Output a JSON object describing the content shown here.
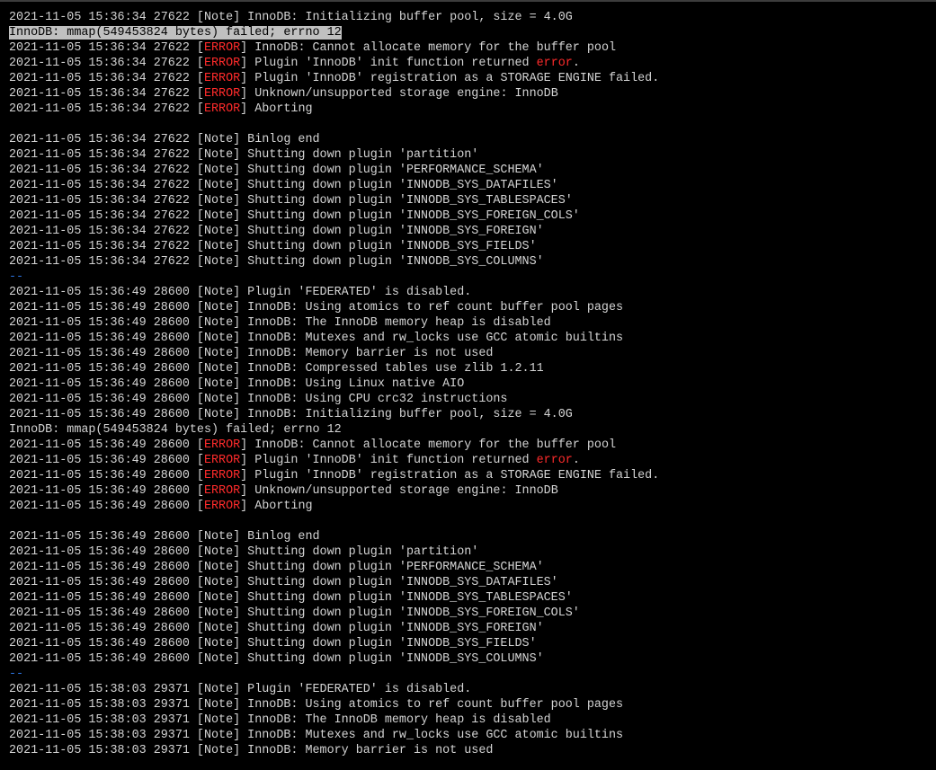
{
  "terminal": {
    "colors": {
      "background": "#000000",
      "text": "#d4d4d4",
      "error": "#ff2b2b",
      "separator": "#2a6fd6",
      "selection": "#c0c0c0"
    },
    "lines": [
      {
        "text": "2021-11-05 15:36:34 27622 [Note] InnoDB: Initializing buffer pool, size = 4.0G"
      },
      {
        "text": "InnoDB: mmap(549453824 bytes) failed; errno 12",
        "highlight": true
      },
      {
        "prefix": "2021-11-05 15:36:34 27622 [",
        "err": "ERROR",
        "suffix": "] InnoDB: Cannot allocate memory for the buffer pool"
      },
      {
        "prefix": "2021-11-05 15:36:34 27622 [",
        "err": "ERROR",
        "suffix": "] Plugin 'InnoDB' init function returned ",
        "err2": "error",
        "tail": "."
      },
      {
        "prefix": "2021-11-05 15:36:34 27622 [",
        "err": "ERROR",
        "suffix": "] Plugin 'InnoDB' registration as a STORAGE ENGINE failed."
      },
      {
        "prefix": "2021-11-05 15:36:34 27622 [",
        "err": "ERROR",
        "suffix": "] Unknown/unsupported storage engine: InnoDB"
      },
      {
        "prefix": "2021-11-05 15:36:34 27622 [",
        "err": "ERROR",
        "suffix": "] Aborting"
      },
      {
        "text": ""
      },
      {
        "text": "2021-11-05 15:36:34 27622 [Note] Binlog end"
      },
      {
        "text": "2021-11-05 15:36:34 27622 [Note] Shutting down plugin 'partition'"
      },
      {
        "text": "2021-11-05 15:36:34 27622 [Note] Shutting down plugin 'PERFORMANCE_SCHEMA'"
      },
      {
        "text": "2021-11-05 15:36:34 27622 [Note] Shutting down plugin 'INNODB_SYS_DATAFILES'"
      },
      {
        "text": "2021-11-05 15:36:34 27622 [Note] Shutting down plugin 'INNODB_SYS_TABLESPACES'"
      },
      {
        "text": "2021-11-05 15:36:34 27622 [Note] Shutting down plugin 'INNODB_SYS_FOREIGN_COLS'"
      },
      {
        "text": "2021-11-05 15:36:34 27622 [Note] Shutting down plugin 'INNODB_SYS_FOREIGN'"
      },
      {
        "text": "2021-11-05 15:36:34 27622 [Note] Shutting down plugin 'INNODB_SYS_FIELDS'"
      },
      {
        "text": "2021-11-05 15:36:34 27622 [Note] Shutting down plugin 'INNODB_SYS_COLUMNS'"
      },
      {
        "text": "--",
        "separator": true
      },
      {
        "text": "2021-11-05 15:36:49 28600 [Note] Plugin 'FEDERATED' is disabled."
      },
      {
        "text": "2021-11-05 15:36:49 28600 [Note] InnoDB: Using atomics to ref count buffer pool pages"
      },
      {
        "text": "2021-11-05 15:36:49 28600 [Note] InnoDB: The InnoDB memory heap is disabled"
      },
      {
        "text": "2021-11-05 15:36:49 28600 [Note] InnoDB: Mutexes and rw_locks use GCC atomic builtins"
      },
      {
        "text": "2021-11-05 15:36:49 28600 [Note] InnoDB: Memory barrier is not used"
      },
      {
        "text": "2021-11-05 15:36:49 28600 [Note] InnoDB: Compressed tables use zlib 1.2.11"
      },
      {
        "text": "2021-11-05 15:36:49 28600 [Note] InnoDB: Using Linux native AIO"
      },
      {
        "text": "2021-11-05 15:36:49 28600 [Note] InnoDB: Using CPU crc32 instructions"
      },
      {
        "text": "2021-11-05 15:36:49 28600 [Note] InnoDB: Initializing buffer pool, size = 4.0G"
      },
      {
        "text": "InnoDB: mmap(549453824 bytes) failed; errno 12"
      },
      {
        "prefix": "2021-11-05 15:36:49 28600 [",
        "err": "ERROR",
        "suffix": "] InnoDB: Cannot allocate memory for the buffer pool"
      },
      {
        "prefix": "2021-11-05 15:36:49 28600 [",
        "err": "ERROR",
        "suffix": "] Plugin 'InnoDB' init function returned ",
        "err2": "error",
        "tail": "."
      },
      {
        "prefix": "2021-11-05 15:36:49 28600 [",
        "err": "ERROR",
        "suffix": "] Plugin 'InnoDB' registration as a STORAGE ENGINE failed."
      },
      {
        "prefix": "2021-11-05 15:36:49 28600 [",
        "err": "ERROR",
        "suffix": "] Unknown/unsupported storage engine: InnoDB"
      },
      {
        "prefix": "2021-11-05 15:36:49 28600 [",
        "err": "ERROR",
        "suffix": "] Aborting"
      },
      {
        "text": ""
      },
      {
        "text": "2021-11-05 15:36:49 28600 [Note] Binlog end"
      },
      {
        "text": "2021-11-05 15:36:49 28600 [Note] Shutting down plugin 'partition'"
      },
      {
        "text": "2021-11-05 15:36:49 28600 [Note] Shutting down plugin 'PERFORMANCE_SCHEMA'"
      },
      {
        "text": "2021-11-05 15:36:49 28600 [Note] Shutting down plugin 'INNODB_SYS_DATAFILES'"
      },
      {
        "text": "2021-11-05 15:36:49 28600 [Note] Shutting down plugin 'INNODB_SYS_TABLESPACES'"
      },
      {
        "text": "2021-11-05 15:36:49 28600 [Note] Shutting down plugin 'INNODB_SYS_FOREIGN_COLS'"
      },
      {
        "text": "2021-11-05 15:36:49 28600 [Note] Shutting down plugin 'INNODB_SYS_FOREIGN'"
      },
      {
        "text": "2021-11-05 15:36:49 28600 [Note] Shutting down plugin 'INNODB_SYS_FIELDS'"
      },
      {
        "text": "2021-11-05 15:36:49 28600 [Note] Shutting down plugin 'INNODB_SYS_COLUMNS'"
      },
      {
        "text": "--",
        "separator": true
      },
      {
        "text": "2021-11-05 15:38:03 29371 [Note] Plugin 'FEDERATED' is disabled."
      },
      {
        "text": "2021-11-05 15:38:03 29371 [Note] InnoDB: Using atomics to ref count buffer pool pages"
      },
      {
        "text": "2021-11-05 15:38:03 29371 [Note] InnoDB: The InnoDB memory heap is disabled"
      },
      {
        "text": "2021-11-05 15:38:03 29371 [Note] InnoDB: Mutexes and rw_locks use GCC atomic builtins"
      },
      {
        "text": "2021-11-05 15:38:03 29371 [Note] InnoDB: Memory barrier is not used"
      }
    ]
  }
}
